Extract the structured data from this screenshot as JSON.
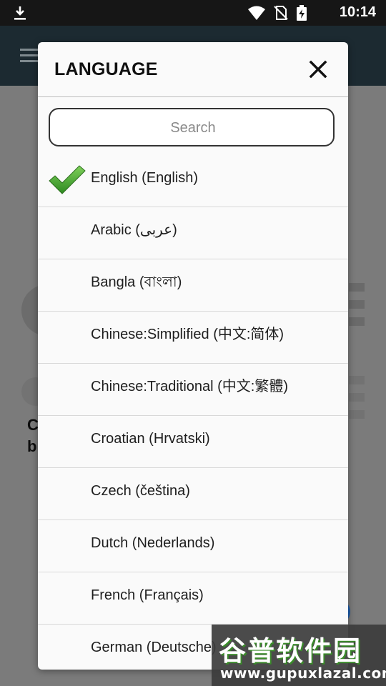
{
  "status_bar": {
    "time": "10:14",
    "icons": [
      "download-icon",
      "wifi-icon",
      "no-sim-icon",
      "battery-charging-icon"
    ]
  },
  "dialog": {
    "title": "LANGUAGE",
    "close_icon": "close-icon",
    "search": {
      "placeholder": "Search",
      "value": ""
    },
    "languages": [
      {
        "label": "English (English)",
        "selected": true
      },
      {
        "label": "Arabic (عربى)",
        "selected": false
      },
      {
        "label": "Bangla (বাংলা)",
        "selected": false
      },
      {
        "label": "Chinese:Simplified (中文:简体)",
        "selected": false
      },
      {
        "label": "Chinese:Traditional (中文:繁體)",
        "selected": false
      },
      {
        "label": "Croatian (Hrvatski)",
        "selected": false
      },
      {
        "label": "Czech (čeština)",
        "selected": false
      },
      {
        "label": "Dutch (Nederlands)",
        "selected": false
      },
      {
        "label": "French (Français)",
        "selected": false
      },
      {
        "label": "German (Deutsche)",
        "selected": false
      }
    ],
    "check_color": "#3aa12a"
  },
  "background": {
    "text_line1": "C",
    "text_line2": "b"
  },
  "watermark": {
    "name": "谷普软件园",
    "url": "www.gupuxlazal.com"
  }
}
